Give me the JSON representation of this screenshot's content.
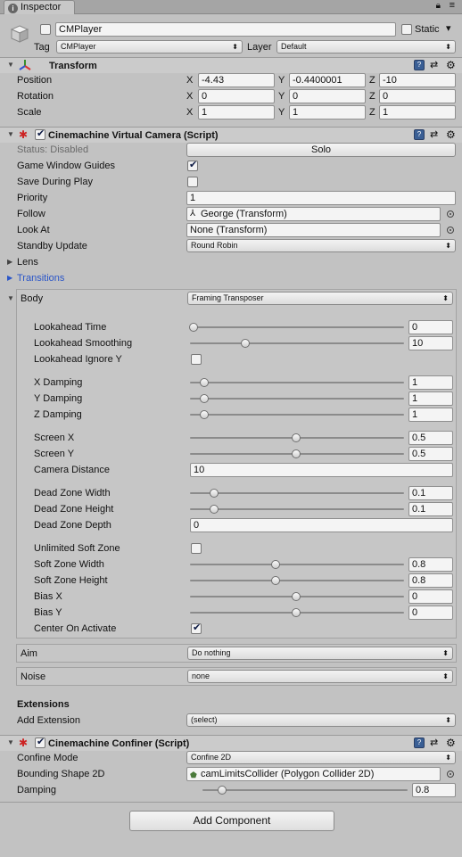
{
  "tab": {
    "title": "Inspector"
  },
  "object": {
    "name": "CMPlayer",
    "static_label": "Static",
    "tag_label": "Tag",
    "tag_value": "CMPlayer",
    "layer_label": "Layer",
    "layer_value": "Default"
  },
  "transform": {
    "title": "Transform",
    "rows": [
      {
        "label": "Position",
        "x": "-4.43",
        "y": "-0.4400001",
        "z": "-10"
      },
      {
        "label": "Rotation",
        "x": "0",
        "y": "0",
        "z": "0"
      },
      {
        "label": "Scale",
        "x": "1",
        "y": "1",
        "z": "1"
      }
    ],
    "axis": {
      "x": "X",
      "y": "Y",
      "z": "Z"
    }
  },
  "vcam": {
    "title": "Cinemachine Virtual Camera (Script)",
    "status_label": "Status: Disabled",
    "solo_button": "Solo",
    "game_window_guides": "Game Window Guides",
    "save_during_play": "Save During Play",
    "priority_label": "Priority",
    "priority_value": "1",
    "follow_label": "Follow",
    "follow_value": "George (Transform)",
    "look_at_label": "Look At",
    "look_at_value": "None (Transform)",
    "standby_label": "Standby Update",
    "standby_value": "Round Robin",
    "lens": "Lens",
    "transitions": "Transitions",
    "body_label": "Body",
    "body_value": "Framing Transposer",
    "aim_label": "Aim",
    "aim_value": "Do nothing",
    "noise_label": "Noise",
    "noise_value": "none",
    "extensions_title": "Extensions",
    "add_extension_label": "Add Extension",
    "add_extension_value": "(select)"
  },
  "body": {
    "lookahead_time": {
      "label": "Lookahead Time",
      "value": "0",
      "fraction": 0.0
    },
    "lookahead_smoothing": {
      "label": "Lookahead Smoothing",
      "value": "10",
      "fraction": 0.25
    },
    "lookahead_ignore_y": {
      "label": "Lookahead Ignore Y"
    },
    "x_damping": {
      "label": "X Damping",
      "value": "1",
      "fraction": 0.05
    },
    "y_damping": {
      "label": "Y Damping",
      "value": "1",
      "fraction": 0.05
    },
    "z_damping": {
      "label": "Z Damping",
      "value": "1",
      "fraction": 0.05
    },
    "screen_x": {
      "label": "Screen X",
      "value": "0.5",
      "fraction": 0.5
    },
    "screen_y": {
      "label": "Screen Y",
      "value": "0.5",
      "fraction": 0.5
    },
    "camera_distance": {
      "label": "Camera Distance",
      "value": "10"
    },
    "dead_zone_width": {
      "label": "Dead Zone Width",
      "value": "0.1",
      "fraction": 0.1
    },
    "dead_zone_height": {
      "label": "Dead Zone Height",
      "value": "0.1",
      "fraction": 0.1
    },
    "dead_zone_depth": {
      "label": "Dead Zone Depth",
      "value": "0"
    },
    "unlimited_soft_zone": {
      "label": "Unlimited Soft Zone"
    },
    "soft_zone_width": {
      "label": "Soft Zone Width",
      "value": "0.8",
      "fraction": 0.4
    },
    "soft_zone_height": {
      "label": "Soft Zone Height",
      "value": "0.8",
      "fraction": 0.4
    },
    "bias_x": {
      "label": "Bias X",
      "value": "0",
      "fraction": 0.5
    },
    "bias_y": {
      "label": "Bias Y",
      "value": "0",
      "fraction": 0.5
    },
    "center_on_activate": {
      "label": "Center On Activate"
    }
  },
  "confiner": {
    "title": "Cinemachine Confiner (Script)",
    "mode_label": "Confine Mode",
    "mode_value": "Confine 2D",
    "shape_label": "Bounding Shape 2D",
    "shape_value": "camLimitsCollider (Polygon Collider 2D)",
    "damping_label": "Damping",
    "damping_value": "0.8",
    "damping_fraction": 0.08
  },
  "add_component": "Add Component",
  "checks": {
    "object_active": false,
    "static": false,
    "vcam_enabled": true,
    "game_window_guides": true,
    "save_during_play": false,
    "lookahead_ignore_y": false,
    "unlimited_soft_zone": false,
    "center_on_activate": true,
    "confiner_enabled": true
  },
  "colors": {
    "link_blue": "#2a55c8",
    "help_blue": "#3a5f95"
  }
}
